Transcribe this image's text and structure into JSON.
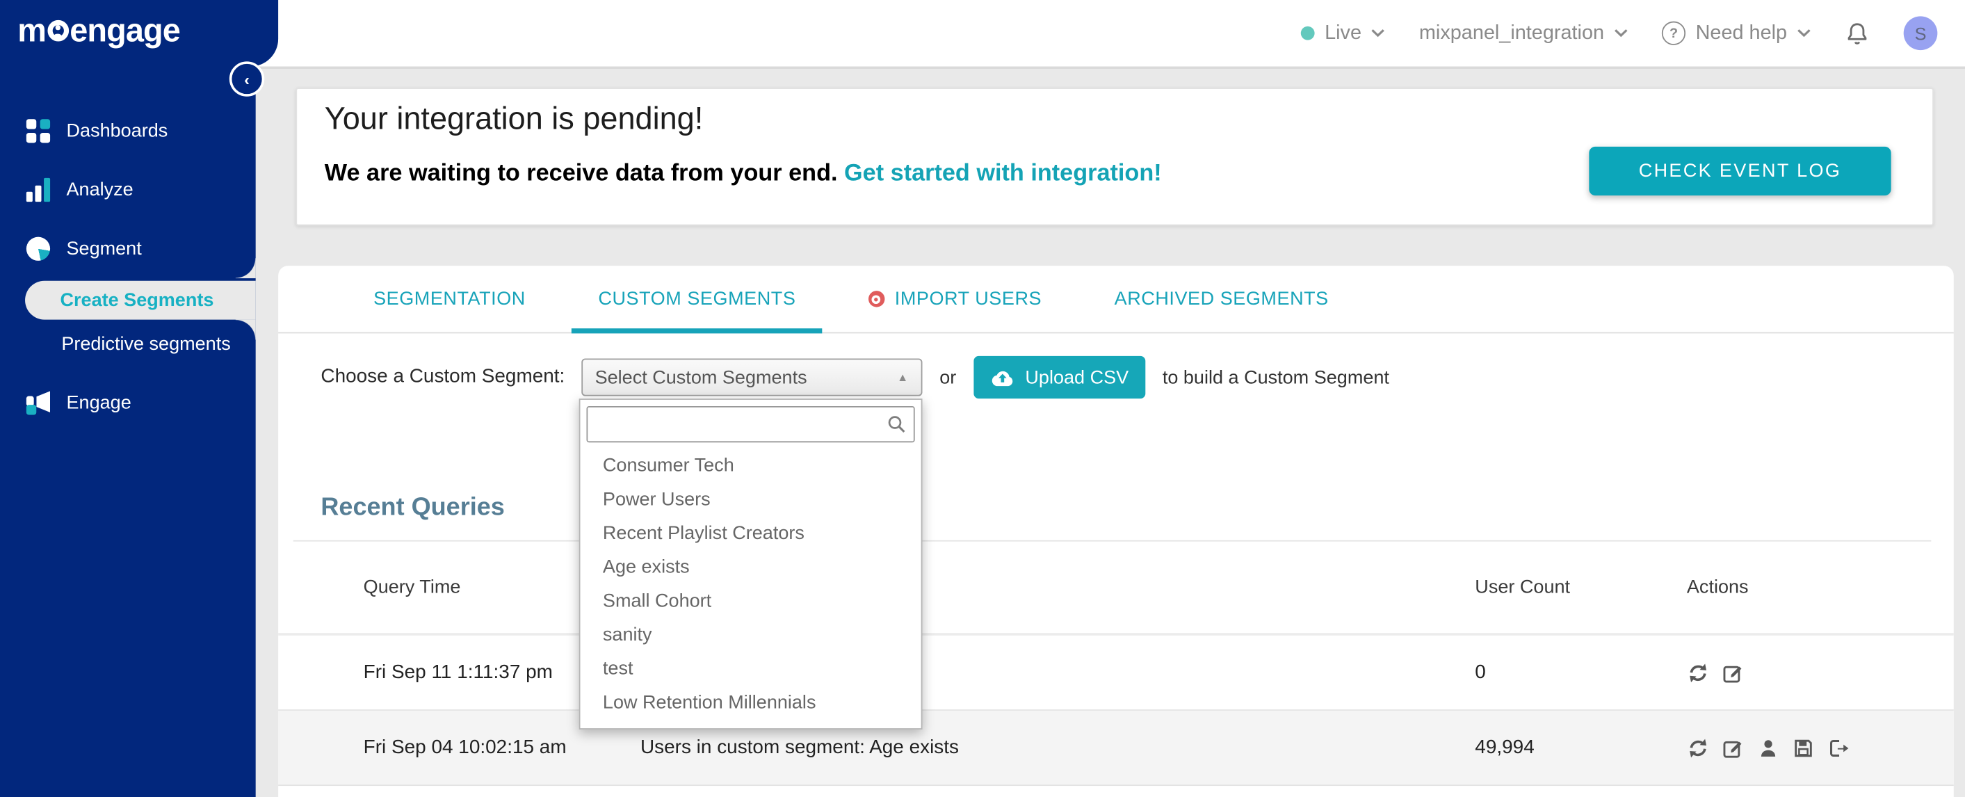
{
  "colors": {
    "sidebar_navy": "#02277D",
    "accent_teal": "#16A7B8",
    "tab_teal": "#17A3B9",
    "import_users_badge_red": "#E05C5C",
    "avatar_lavender": "#98A2F1",
    "live_dot_teal": "#63C9BD",
    "page_background": "#E9E9E9",
    "recent_queries_heading": "#567E95"
  },
  "brand": {
    "logo_prefix": "m",
    "logo_suffix": "engage"
  },
  "topbar": {
    "live_label": "Live",
    "workspace": "mixpanel_integration",
    "help_label": "Need help",
    "avatar_initial": "S"
  },
  "sidebar": {
    "items": [
      {
        "label": "Dashboards"
      },
      {
        "label": "Analyze"
      },
      {
        "label": "Segment"
      }
    ],
    "sub_items": [
      {
        "label": "Create Segments",
        "active": true
      },
      {
        "label": "Predictive segments",
        "active": false
      }
    ],
    "engage_label": "Engage"
  },
  "banner": {
    "title": "Your integration is pending!",
    "message": "We are waiting to receive data from your end.",
    "link": "Get started with integration!",
    "button": "CHECK EVENT LOG"
  },
  "tabs": [
    {
      "label": "SEGMENTATION",
      "active": false
    },
    {
      "label": "CUSTOM SEGMENTS",
      "active": true
    },
    {
      "label": "IMPORT USERS",
      "active": false,
      "badge": "red-dot"
    },
    {
      "label": "ARCHIVED SEGMENTS",
      "active": false
    }
  ],
  "picker": {
    "label": "Choose a Custom Segment:",
    "select_value": "Select Custom Segments",
    "or": "or",
    "upload_button": "Upload CSV",
    "suffix": "to build a Custom Segment",
    "search_value": "",
    "options": [
      "Consumer Tech",
      "Power Users",
      "Recent Playlist Creators",
      "Age exists",
      "Small Cohort",
      "sanity",
      "test",
      "Low Retention Millennials"
    ]
  },
  "recent_queries": {
    "title": "Recent Queries",
    "columns": {
      "time": "Query Time",
      "query": "",
      "count": "User Count",
      "actions": "Actions"
    },
    "rows": [
      {
        "time": "Fri Sep 11 1:11:37 pm",
        "query": "",
        "count": "0",
        "actions": [
          "refresh",
          "edit"
        ]
      },
      {
        "time": "Fri Sep 04 10:02:15 am",
        "query": "Users in custom segment: Age exists",
        "count": "49,994",
        "actions": [
          "refresh",
          "edit",
          "user",
          "save",
          "export"
        ]
      }
    ]
  }
}
